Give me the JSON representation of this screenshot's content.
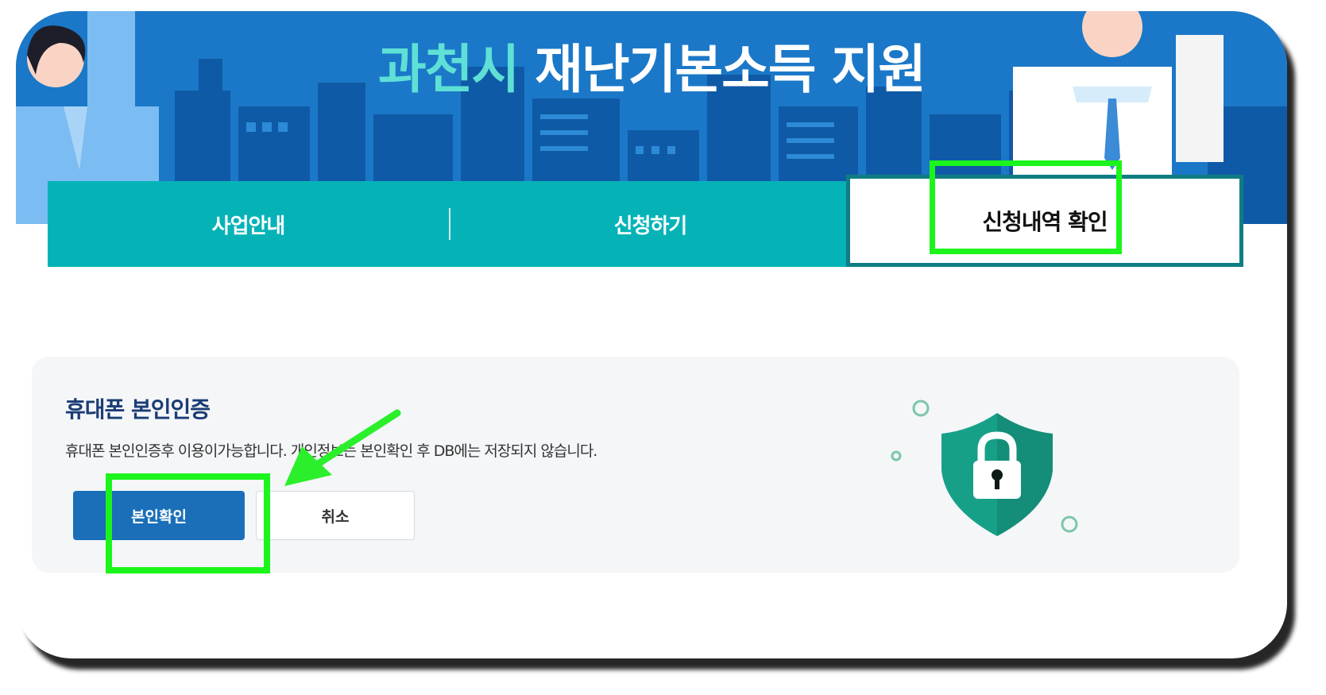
{
  "banner": {
    "title_highlight": "과천시",
    "title_rest": "재난기본소득 지원"
  },
  "tabs": [
    {
      "label": "사업안내",
      "active": false
    },
    {
      "label": "신청하기",
      "active": false
    },
    {
      "label": "신청내역 확인",
      "active": true
    }
  ],
  "verification": {
    "title": "휴대폰 본인인증",
    "description": "휴대폰 본인인증후 이용이가능합니다. 개인정보는 본인확인 후 DB에는 저장되지 않습니다.",
    "confirm_label": "본인확인",
    "cancel_label": "취소"
  },
  "icons": [
    "lock-shield-icon",
    "arrow-icon"
  ],
  "colors": {
    "banner": "#1874c4",
    "tab": "#05b3b7",
    "primary_button": "#1a6fb8",
    "highlight": "#1bf51b",
    "shield": "#16a08a"
  }
}
